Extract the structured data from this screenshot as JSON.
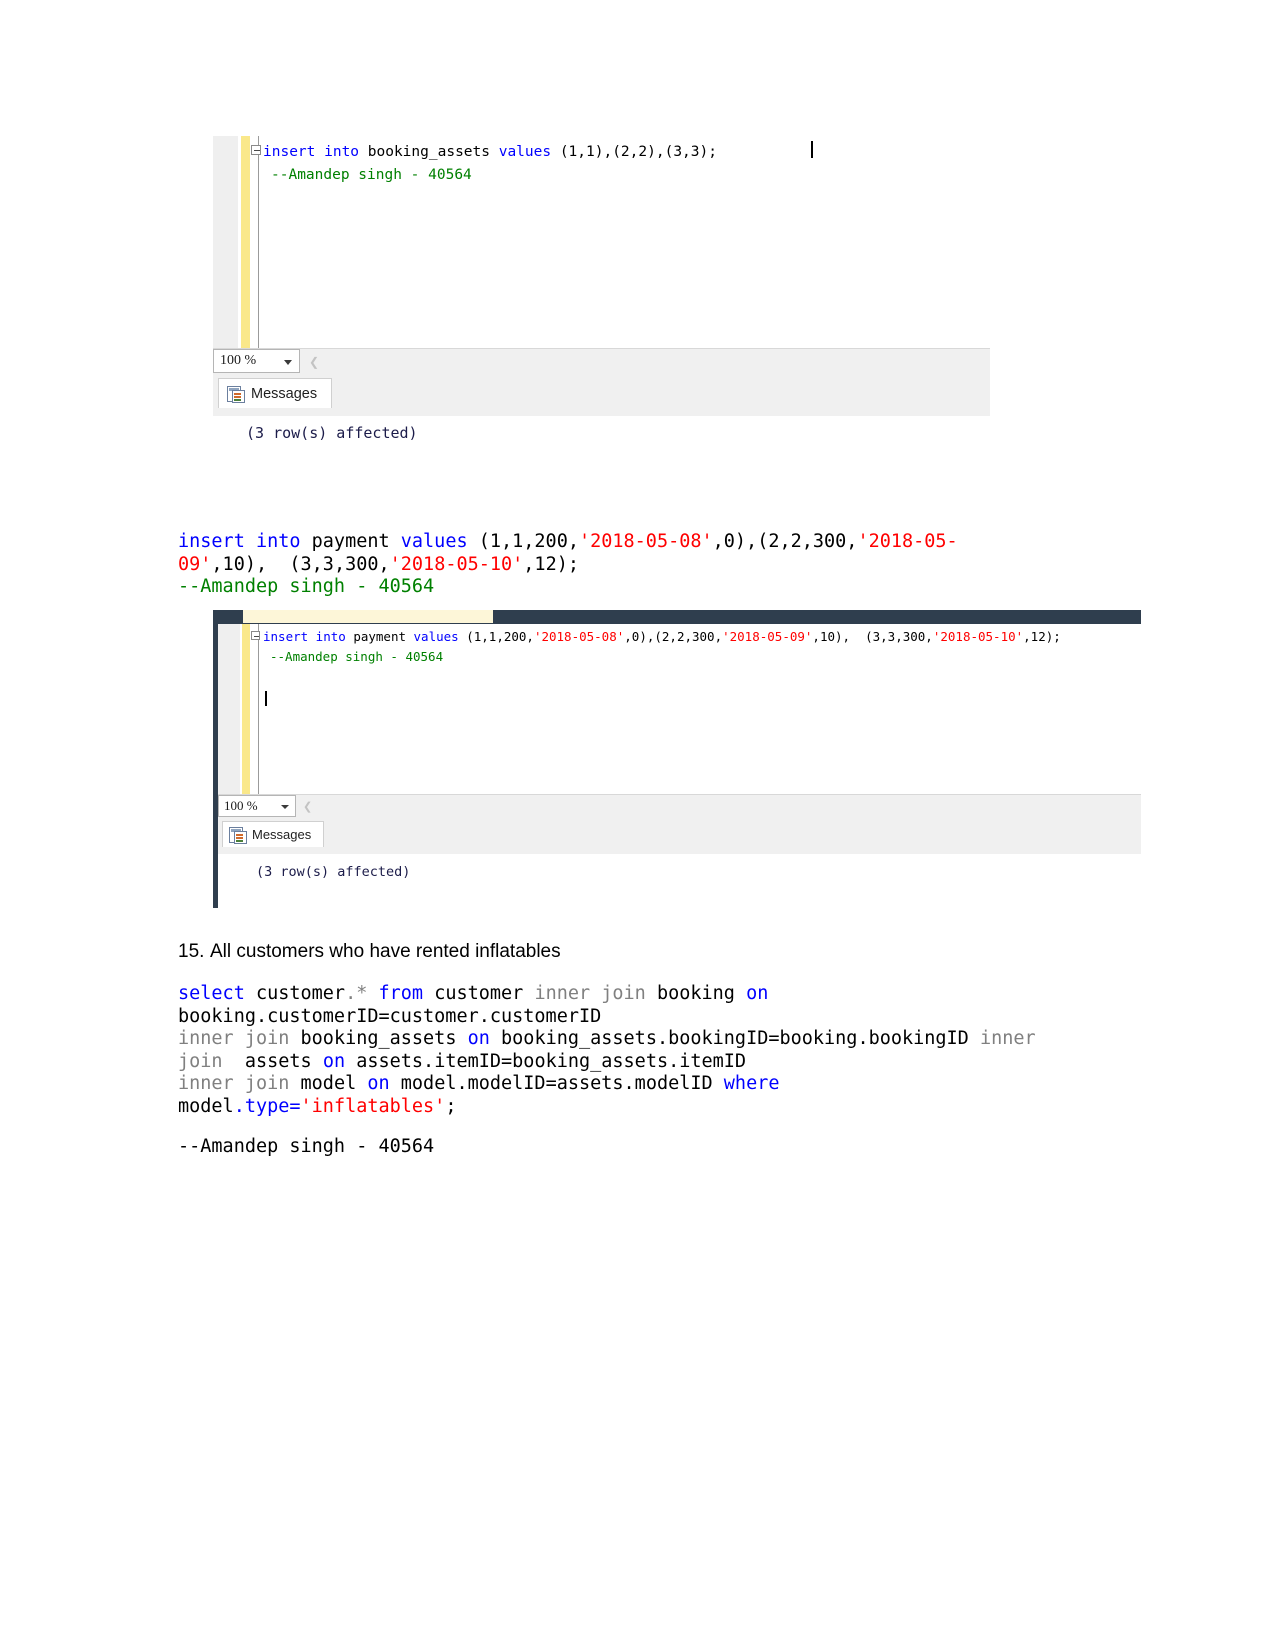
{
  "document": {
    "type": "sql-assignment-document",
    "author_signature": "--Amandep singh - 40564"
  },
  "screenshot1": {
    "editor": {
      "line1_parts": [
        {
          "text": "insert into ",
          "style": "keyword-blue"
        },
        {
          "text": "booking_assets ",
          "style": "plain"
        },
        {
          "text": "values ",
          "style": "keyword-blue"
        },
        {
          "text": "(1,1),(2,2),(3,3);",
          "style": "plain"
        }
      ],
      "line1_full": "insert into booking_assets values (1,1),(2,2),(3,3);",
      "line2": "--Amandep singh - 40564"
    },
    "zoom_level": "100 %",
    "tab_label": "Messages",
    "message_text": "(3 row(s) affected)"
  },
  "payment_statement": {
    "segments": [
      {
        "text": "insert into ",
        "style": "keyword-blue"
      },
      {
        "text": "payment ",
        "style": "plain"
      },
      {
        "text": "values ",
        "style": "keyword-blue"
      },
      {
        "text": "(1,1,200,",
        "style": "plain"
      },
      {
        "text": "'2018-05-08'",
        "style": "string-red"
      },
      {
        "text": ",0),(2,2,300,",
        "style": "plain"
      },
      {
        "text": "'2018-05-09'",
        "style": "string-red"
      },
      {
        "text": ",10),  (3,3,300,",
        "style": "plain"
      },
      {
        "text": "'2018-05-10'",
        "style": "string-red"
      },
      {
        "text": ",12);",
        "style": "plain"
      }
    ],
    "full_text": "insert into payment values (1,1,200,'2018-05-08',0),(2,2,300,'2018-05-09',10),  (3,3,300,'2018-05-10',12);",
    "comment": "--Amandep singh - 40564"
  },
  "screenshot2": {
    "editor": {
      "line1_full": "insert into payment values (1,1,200,'2018-05-08',0),(2,2,300,'2018-05-09',10),  (3,3,300,'2018-05-10',12);",
      "line2": "--Amandep singh - 40564"
    },
    "zoom_level": "100 %",
    "tab_label": "Messages",
    "message_text": "(3 row(s) affected)"
  },
  "question": {
    "number": "15.",
    "text": "All customers who have rented inflatables"
  },
  "select_statement": {
    "segments": [
      {
        "text": "select ",
        "style": "keyword-blue"
      },
      {
        "text": "customer",
        "style": "plain"
      },
      {
        "text": ".*",
        "style": "operator-grey"
      },
      {
        "text": " from ",
        "style": "keyword-blue"
      },
      {
        "text": "customer ",
        "style": "plain"
      },
      {
        "text": "inner join ",
        "style": "keyword-grey"
      },
      {
        "text": "booking ",
        "style": "plain"
      },
      {
        "text": "on",
        "style": "keyword-blue"
      },
      {
        "text": "\nbooking.customerID=customer.customerID\n",
        "style": "plain"
      },
      {
        "text": "inner join ",
        "style": "keyword-grey"
      },
      {
        "text": "booking_assets ",
        "style": "plain"
      },
      {
        "text": "on ",
        "style": "keyword-blue"
      },
      {
        "text": "booking_assets.bookingID=booking.bookingID ",
        "style": "plain"
      },
      {
        "text": "inner\njoin ",
        "style": "keyword-grey"
      },
      {
        "text": " assets ",
        "style": "plain"
      },
      {
        "text": "on ",
        "style": "keyword-blue"
      },
      {
        "text": "assets.itemID=booking_assets.itemID\n",
        "style": "plain"
      },
      {
        "text": "inner join ",
        "style": "keyword-grey"
      },
      {
        "text": "model ",
        "style": "plain"
      },
      {
        "text": "on ",
        "style": "keyword-blue"
      },
      {
        "text": "model.modelID=assets.modelID ",
        "style": "plain"
      },
      {
        "text": "where",
        "style": "keyword-blue"
      },
      {
        "text": "\nmodel",
        "style": "plain"
      },
      {
        "text": ".type=",
        "style": "keyword-blue"
      },
      {
        "text": "'inflatables'",
        "style": "string-red"
      },
      {
        "text": ";",
        "style": "plain"
      }
    ],
    "full_text": "select customer.* from customer inner join booking on booking.customerID=customer.customerID inner join booking_assets on booking_assets.bookingID=booking.bookingID inner join  assets on assets.itemID=booking_assets.itemID inner join model on model.modelID=assets.modelID where model.type='inflatables';",
    "comment": "--Amandep singh - 40564"
  },
  "colors": {
    "keyword_blue": "#0000ff",
    "keyword_grey": "#808080",
    "string_red": "#ff0000",
    "comment_green": "#008000",
    "gutter_yellow": "#fae88a",
    "chrome_grey": "#f0f0f0"
  }
}
